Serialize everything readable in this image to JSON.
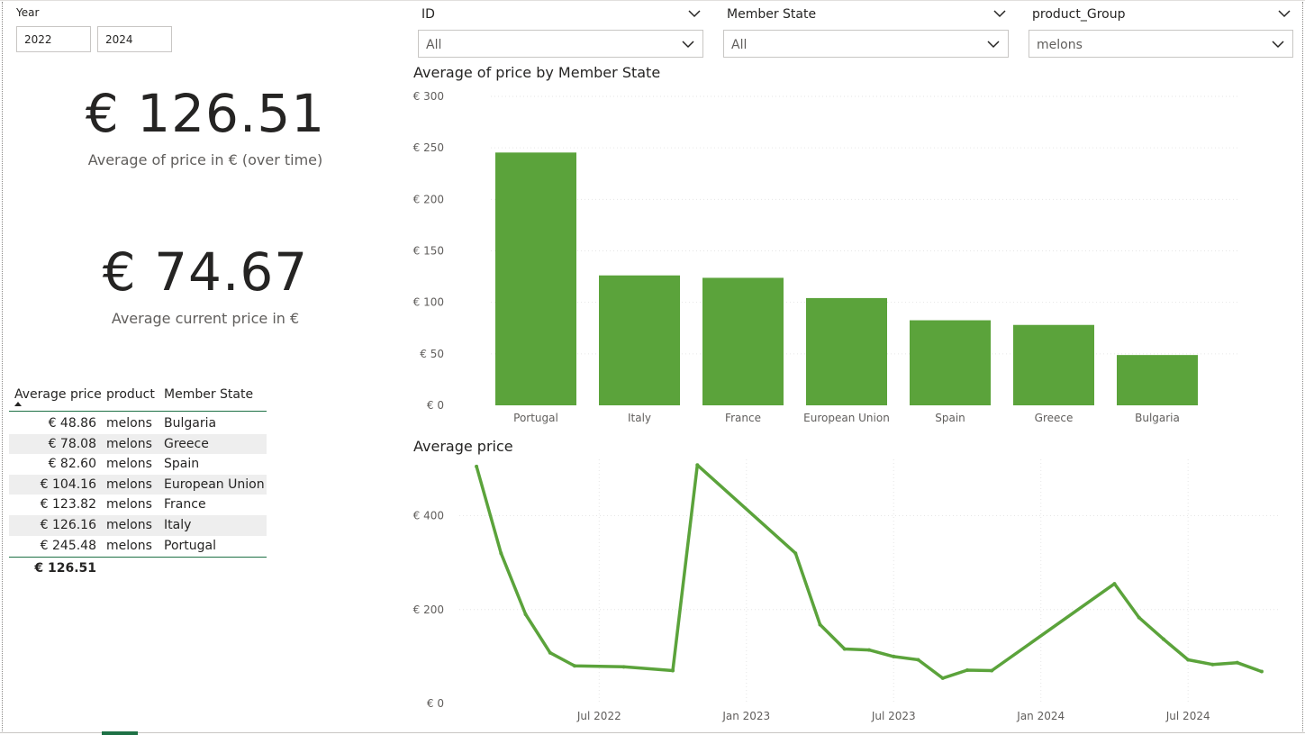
{
  "slicers": {
    "year": {
      "title": "Year",
      "from": "2022",
      "to": "2024"
    },
    "id": {
      "title": "ID",
      "value": "All"
    },
    "member_state": {
      "title": "Member State",
      "value": "All"
    },
    "product_group": {
      "title": "product_Group",
      "value": "melons"
    }
  },
  "kpis": {
    "avg_price_over_time": {
      "value": "€ 126.51",
      "label": "Average of price in € (over time)"
    },
    "avg_current_price": {
      "value": "€ 74.67",
      "label": "Average current price in €"
    }
  },
  "table": {
    "headers": [
      "Average price",
      "product",
      "Member State"
    ],
    "sort": "ascending",
    "rows": [
      {
        "price": "€ 48.86",
        "product": "melons",
        "state": "Bulgaria"
      },
      {
        "price": "€ 78.08",
        "product": "melons",
        "state": "Greece"
      },
      {
        "price": "€ 82.60",
        "product": "melons",
        "state": "Spain"
      },
      {
        "price": "€ 104.16",
        "product": "melons",
        "state": "European Union"
      },
      {
        "price": "€ 123.82",
        "product": "melons",
        "state": "France"
      },
      {
        "price": "€ 126.16",
        "product": "melons",
        "state": "Italy"
      },
      {
        "price": "€ 245.48",
        "product": "melons",
        "state": "Portugal"
      }
    ],
    "total": "€ 126.51"
  },
  "colors": {
    "accent": "#1e7145",
    "bar": "#5ba33b",
    "line": "#5ba33b",
    "grid": "#e6e6e6"
  },
  "icons": {
    "dropdown": "chevron-down-icon",
    "sort": "sort-ascending-icon"
  },
  "chart_data": [
    {
      "type": "bar",
      "title": "Average of price by Member State",
      "categories": [
        "Portugal",
        "Italy",
        "France",
        "European Union",
        "Spain",
        "Greece",
        "Bulgaria"
      ],
      "values": [
        245.48,
        126.16,
        123.82,
        104.16,
        82.6,
        78.08,
        48.86
      ],
      "ylim": [
        0,
        300
      ],
      "yticks": [
        "€ 0",
        "€ 50",
        "€ 100",
        "€ 150",
        "€ 200",
        "€ 250",
        "€ 300"
      ],
      "ytick_values": [
        0,
        50,
        100,
        150,
        200,
        250,
        300
      ],
      "grid": true
    },
    {
      "type": "line",
      "title": "Average price",
      "x": [
        "2022-02",
        "2022-03",
        "2022-04",
        "2022-05",
        "2022-06",
        "2022-08",
        "2022-10",
        "2022-11",
        "2023-03",
        "2023-04",
        "2023-05",
        "2023-06",
        "2023-07",
        "2023-08",
        "2023-09",
        "2023-10",
        "2023-11",
        "2024-04",
        "2024-05",
        "2024-06",
        "2024-07",
        "2024-08",
        "2024-09",
        "2024-10"
      ],
      "y": [
        505,
        320,
        190,
        108,
        80,
        78,
        70,
        508,
        320,
        168,
        116,
        114,
        100,
        93,
        54,
        71,
        70,
        255,
        183,
        137,
        93,
        83,
        87,
        68
      ],
      "ylim": [
        0,
        500
      ],
      "yticks": [
        "€ 0",
        "€ 200",
        "€ 400"
      ],
      "ytick_values": [
        0,
        200,
        400
      ],
      "xticks": [
        "Jul 2022",
        "Jan 2023",
        "Jul 2023",
        "Jan 2024",
        "Jul 2024"
      ],
      "xtick_dates": [
        "2022-07",
        "2023-01",
        "2023-07",
        "2024-01",
        "2024-07"
      ],
      "grid": true
    }
  ]
}
